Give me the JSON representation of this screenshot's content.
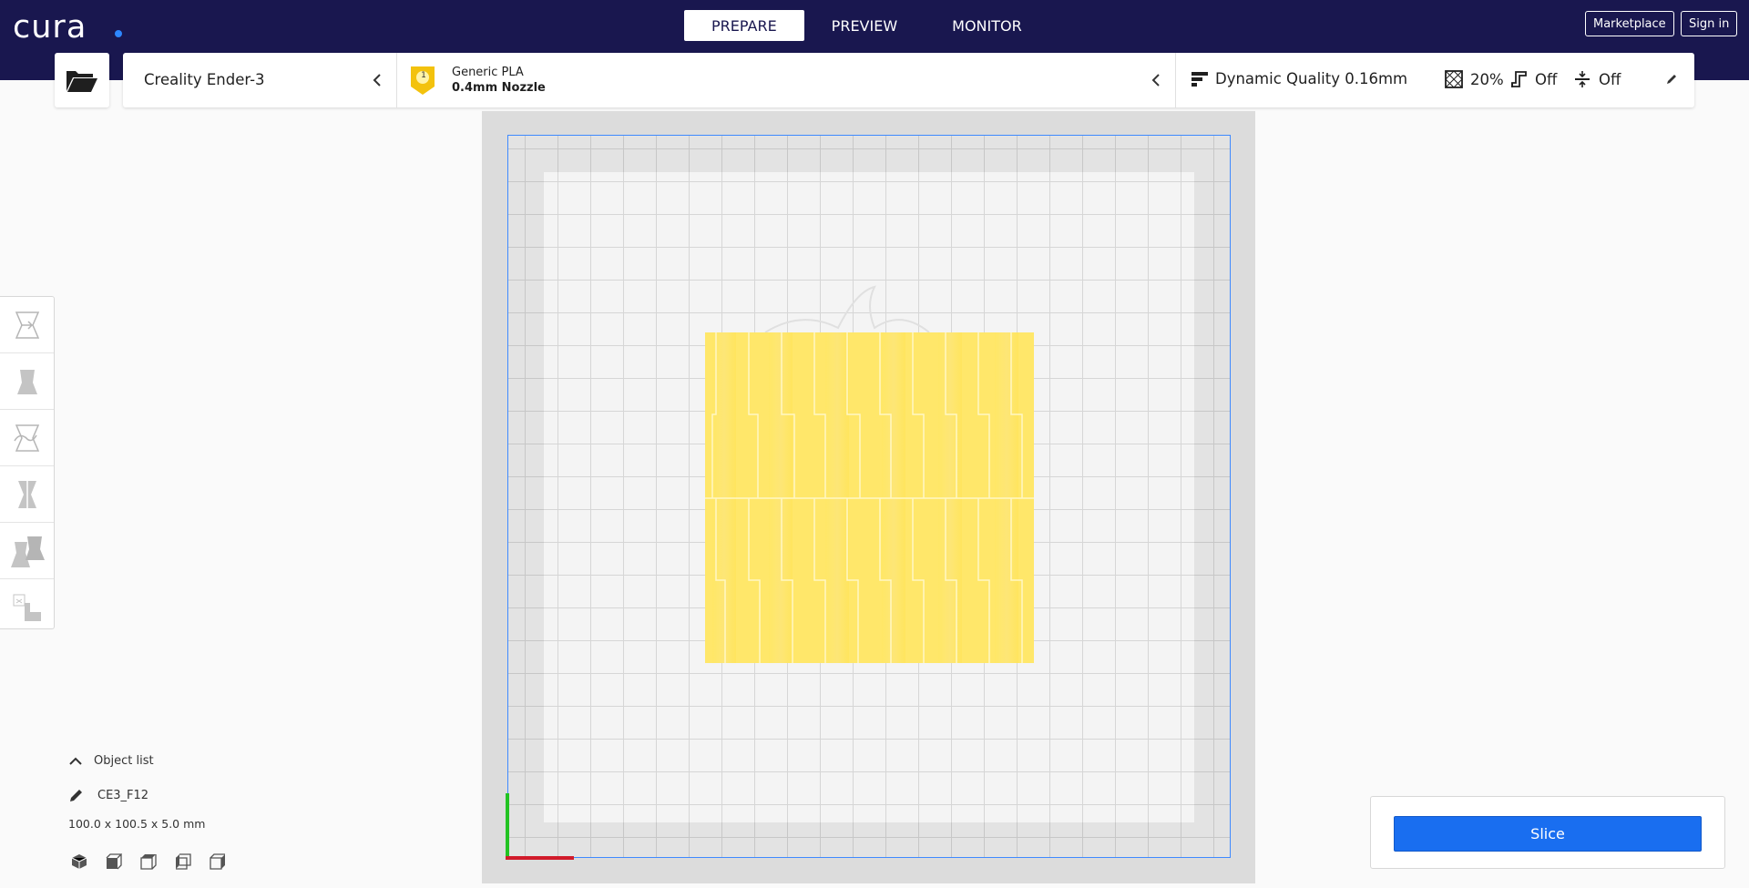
{
  "header": {
    "logo": "cura",
    "stages": [
      "PREPARE",
      "PREVIEW",
      "MONITOR"
    ],
    "active_stage": "PREPARE",
    "marketplace_label": "Marketplace",
    "signin_label": "Sign in"
  },
  "config": {
    "printer": "Creality Ender-3",
    "extruder_number": "1",
    "material": "Generic PLA",
    "nozzle": "0.4mm Nozzle",
    "profile": "Dynamic Quality 0.16mm",
    "infill": "20%",
    "support": "Off",
    "adhesion": "Off"
  },
  "toolbar": {
    "tools": [
      "move-icon",
      "scale-icon",
      "rotate-icon",
      "mirror-icon",
      "per-model-settings-icon",
      "support-blocker-icon"
    ]
  },
  "object_list": {
    "header": "Object list",
    "object_name": "CE3_F12",
    "dimensions": "100.0 x 100.5 x 5.0 mm"
  },
  "view_buttons": [
    "3d-view-icon",
    "front-view-icon",
    "top-view-icon",
    "left-view-icon",
    "right-view-icon"
  ],
  "slice": {
    "label": "Slice"
  },
  "colors": {
    "header_bg": "#19174f",
    "accent": "#196ef0",
    "model": "#ffe866",
    "plate_outline": "#3f8aff"
  }
}
